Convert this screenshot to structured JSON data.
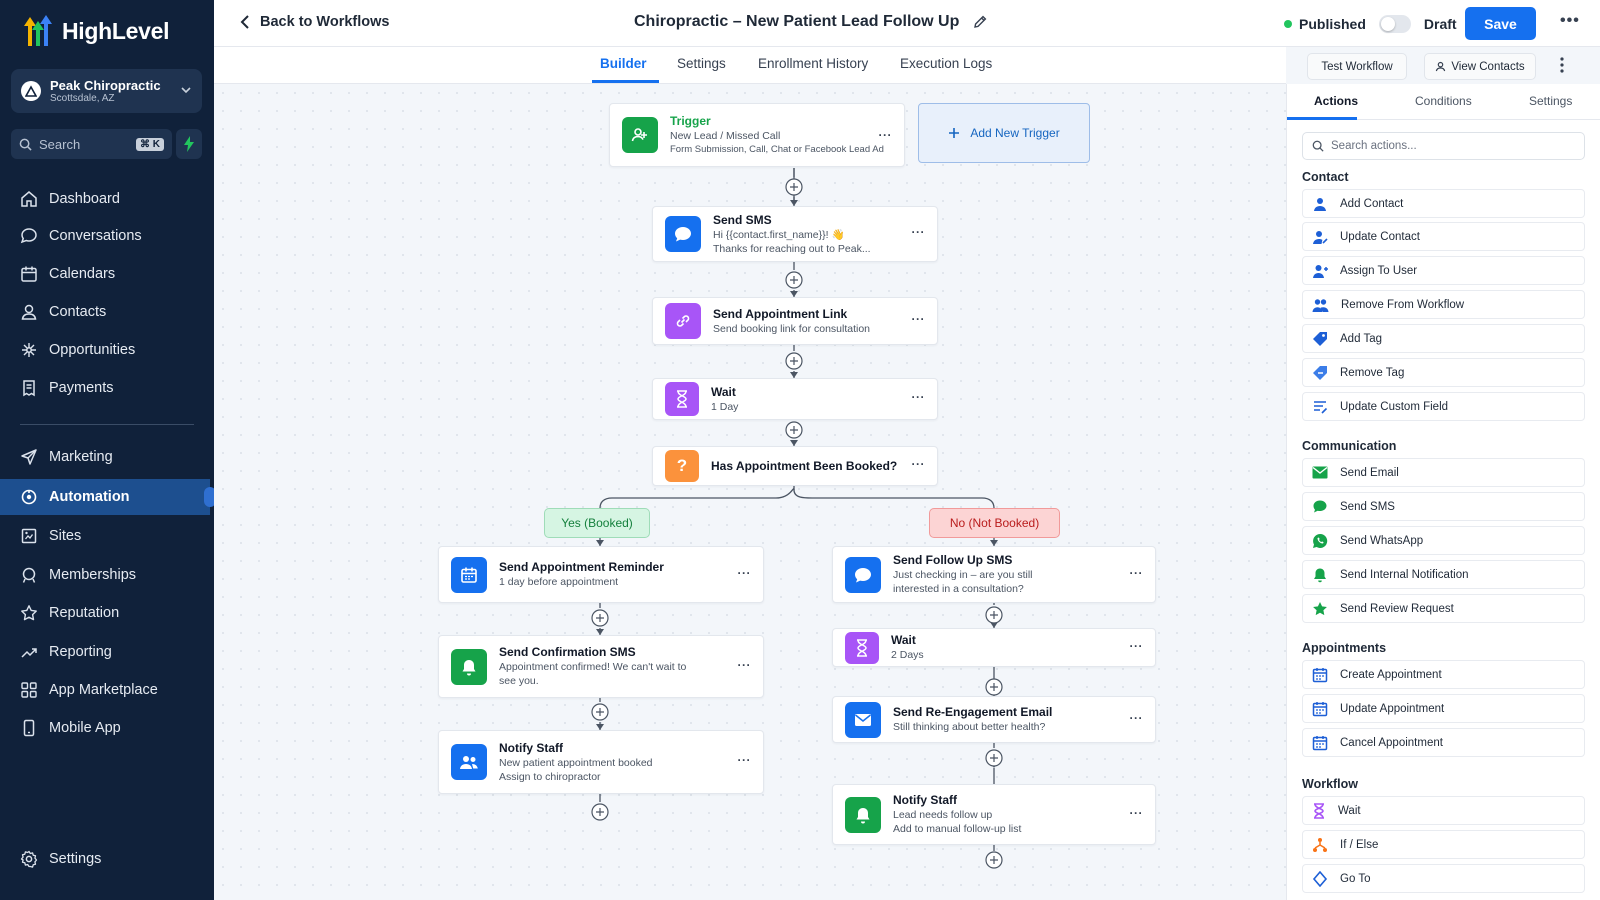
{
  "sidebar": {
    "logo_text": "HighLevel",
    "account": {
      "name": "Peak Chiropractic",
      "location": "Scottsdale, AZ"
    },
    "search": {
      "label": "Search",
      "shortcut": "⌘ K"
    },
    "items": [
      {
        "label": "Dashboard",
        "icon": "home-icon"
      },
      {
        "label": "Conversations",
        "icon": "chat-icon"
      },
      {
        "label": "Calendars",
        "icon": "calendar-icon"
      },
      {
        "label": "Contacts",
        "icon": "person-icon"
      },
      {
        "label": "Opportunities",
        "icon": "network-icon"
      },
      {
        "label": "Payments",
        "icon": "receipt-icon"
      },
      {
        "label": "Marketing",
        "icon": "send-icon"
      },
      {
        "label": "Automation",
        "icon": "automation-icon",
        "active": true
      },
      {
        "label": "Sites",
        "icon": "sites-icon"
      },
      {
        "label": "Memberships",
        "icon": "membership-icon"
      },
      {
        "label": "Reputation",
        "icon": "star-icon"
      },
      {
        "label": "Reporting",
        "icon": "trend-icon"
      },
      {
        "label": "App Marketplace",
        "icon": "grid-icon"
      },
      {
        "label": "Mobile App",
        "icon": "phone-icon"
      }
    ],
    "settings_label": "Settings"
  },
  "header": {
    "back_label": "Back to Workflows",
    "title": "Chiropractic – New Patient Lead Follow Up",
    "published_label": "Published",
    "draft_label": "Draft",
    "save_label": "Save"
  },
  "tabs": [
    "Builder",
    "Settings",
    "Enrollment History",
    "Execution Logs"
  ],
  "toolbar": {
    "test_label": "Test Workflow",
    "view_contacts_label": "View Contacts"
  },
  "workflow": {
    "trigger": {
      "title": "Trigger",
      "line1": "New Lead / Missed Call",
      "line2": "Form Submission, Call, Chat or Facebook Lead Ad"
    },
    "add_trigger_label": "Add New Trigger",
    "main_steps": [
      {
        "title": "Send SMS",
        "line1": "Hi {{contact.first_name}}! 👋",
        "line2": "Thanks for reaching out to Peak..."
      },
      {
        "title": "Send Appointment Link",
        "line1": "Send booking link for consultation"
      },
      {
        "title": "Wait",
        "line1": "1 Day"
      },
      {
        "title": "Has Appointment Been Booked?"
      }
    ],
    "yes_label": "Yes (Booked)",
    "no_label": "No (Not Booked)",
    "yes_steps": [
      {
        "title": "Send Appointment Reminder",
        "line1": "1 day before appointment"
      },
      {
        "title": "Send Confirmation SMS",
        "line1": "Appointment confirmed! We can't wait to",
        "line2": "see you."
      },
      {
        "title": "Notify Staff",
        "line1": "New patient appointment booked",
        "line2": "Assign to chiropractor"
      }
    ],
    "no_steps": [
      {
        "title": "Send Follow Up SMS",
        "line1": "Just checking in – are you still",
        "line2": "interested in a consultation?"
      },
      {
        "title": "Wait",
        "line1": "2 Days"
      },
      {
        "title": "Send Re-Engagement Email",
        "line1": "Still thinking about better health?"
      },
      {
        "title": "Notify Staff",
        "line1": "Lead needs follow up",
        "line2": "Add to manual follow-up list"
      }
    ]
  },
  "panel": {
    "tabs": [
      "Actions",
      "Conditions",
      "Settings"
    ],
    "search_placeholder": "Search actions...",
    "sections": [
      {
        "title": "Contact",
        "items": [
          "Add Contact",
          "Update Contact",
          "Assign To User",
          "Remove From Workflow",
          "Add Tag",
          "Remove Tag",
          "Update Custom Field"
        ]
      },
      {
        "title": "Communication",
        "items": [
          "Send Email",
          "Send SMS",
          "Send WhatsApp",
          "Send Internal Notification",
          "Send Review Request"
        ]
      },
      {
        "title": "Appointments",
        "items": [
          "Create Appointment",
          "Update Appointment",
          "Cancel Appointment"
        ]
      },
      {
        "title": "Workflow",
        "items": [
          "Wait",
          "If / Else",
          "Go To"
        ]
      }
    ]
  },
  "colors": {
    "sidebar_bg": "#10213a",
    "accent": "#1570ef",
    "active_nav": "#1d4f8f",
    "success": "#22c55e"
  }
}
